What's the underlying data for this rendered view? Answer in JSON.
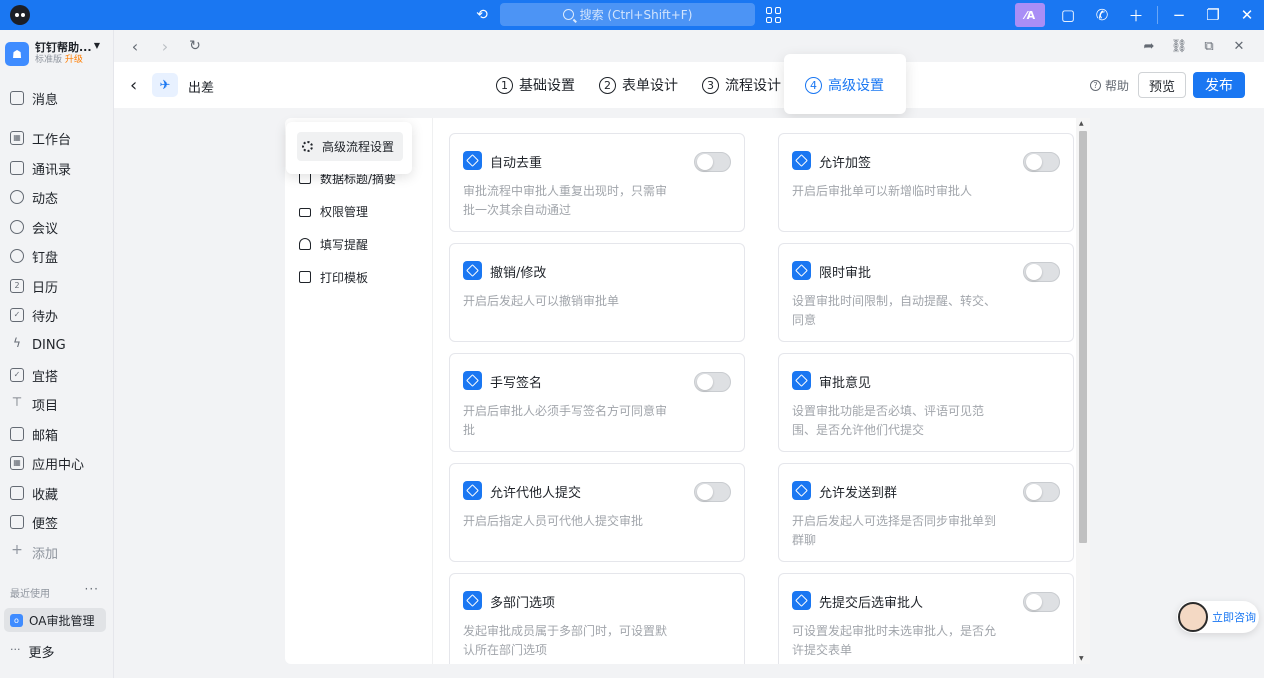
{
  "titlebar": {
    "search_placeholder": "搜索 (Ctrl+Shift+F)",
    "icons": [
      "history-icon",
      "search-icon",
      "apps-grid-icon",
      "ai-icon",
      "chat-bubble-icon",
      "phone-icon",
      "plus-icon",
      "minimize-icon",
      "restore-icon",
      "close-icon"
    ]
  },
  "sidebar": {
    "org_name": "钉钉帮助...",
    "org_edition": "标准版",
    "org_upgrade": "升级",
    "items": [
      {
        "label": "消息",
        "icon": "message-icon"
      },
      {
        "label": "工作台",
        "icon": "workbench-icon"
      },
      {
        "label": "通讯录",
        "icon": "contacts-icon"
      },
      {
        "label": "动态",
        "icon": "feed-icon"
      },
      {
        "label": "会议",
        "icon": "meeting-icon"
      },
      {
        "label": "钉盘",
        "icon": "drive-icon"
      },
      {
        "label": "日历",
        "icon": "calendar-icon"
      },
      {
        "label": "待办",
        "icon": "todo-icon"
      },
      {
        "label": "DING",
        "icon": "ding-icon"
      },
      {
        "label": "宜搭",
        "icon": "yida-icon"
      },
      {
        "label": "项目",
        "icon": "project-icon"
      },
      {
        "label": "邮箱",
        "icon": "mail-icon"
      },
      {
        "label": "应用中心",
        "icon": "app-center-icon"
      },
      {
        "label": "收藏",
        "icon": "favorites-icon"
      },
      {
        "label": "便签",
        "icon": "notes-icon"
      }
    ],
    "add_label": "添加",
    "recent_title": "最近使用",
    "recent_more": "···",
    "recent_item": "OA审批管理",
    "more_label": "更多",
    "more_icon": "···"
  },
  "header": {
    "title": "出差",
    "steps": [
      {
        "num": "1",
        "label": "基础设置"
      },
      {
        "num": "2",
        "label": "表单设计"
      },
      {
        "num": "3",
        "label": "流程设计"
      },
      {
        "num": "4",
        "label": "高级设置"
      }
    ],
    "active_step": 4,
    "help_label": "帮助",
    "preview_label": "预览",
    "publish_label": "发布"
  },
  "subnav": {
    "items": [
      "高级流程设置",
      "数据标题/摘要",
      "权限管理",
      "填写提醒",
      "打印模板"
    ],
    "active_index": 0
  },
  "cards": [
    {
      "title": "自动去重",
      "desc": "审批流程中审批人重复出现时，只需审批一次其余自动通过",
      "toggle": true,
      "enabled": false
    },
    {
      "title": "允许加签",
      "desc": "开启后审批单可以新增临时审批人",
      "toggle": true,
      "enabled": false
    },
    {
      "title": "撤销/修改",
      "desc": "开启后发起人可以撤销审批单",
      "toggle": false
    },
    {
      "title": "限时审批",
      "desc": "设置审批时间限制，自动提醒、转交、同意",
      "toggle": true,
      "enabled": false
    },
    {
      "title": "手写签名",
      "desc": "开启后审批人必须手写签名方可同意审批",
      "toggle": true,
      "enabled": false
    },
    {
      "title": "审批意见",
      "desc": "设置审批功能是否必填、评语可见范围、是否允许他们代提交",
      "toggle": false
    },
    {
      "title": "允许代他人提交",
      "desc": "开启后指定人员可代他人提交审批",
      "toggle": true,
      "enabled": false
    },
    {
      "title": "允许发送到群",
      "desc": "开启后发起人可选择是否同步审批单到群聊",
      "toggle": true,
      "enabled": false
    },
    {
      "title": "多部门选项",
      "desc": "发起审批成员属于多部门时，可设置默认所在部门选项",
      "toggle": false
    },
    {
      "title": "先提交后选审批人",
      "desc": "可设置发起审批时未选审批人，是否允许提交表单",
      "toggle": true,
      "enabled": false
    }
  ],
  "consult": {
    "label": "立即咨询"
  },
  "colors": {
    "accent": "#1a77f2",
    "titlebar": "#1a77f2",
    "upgrade": "#ff7d00"
  }
}
